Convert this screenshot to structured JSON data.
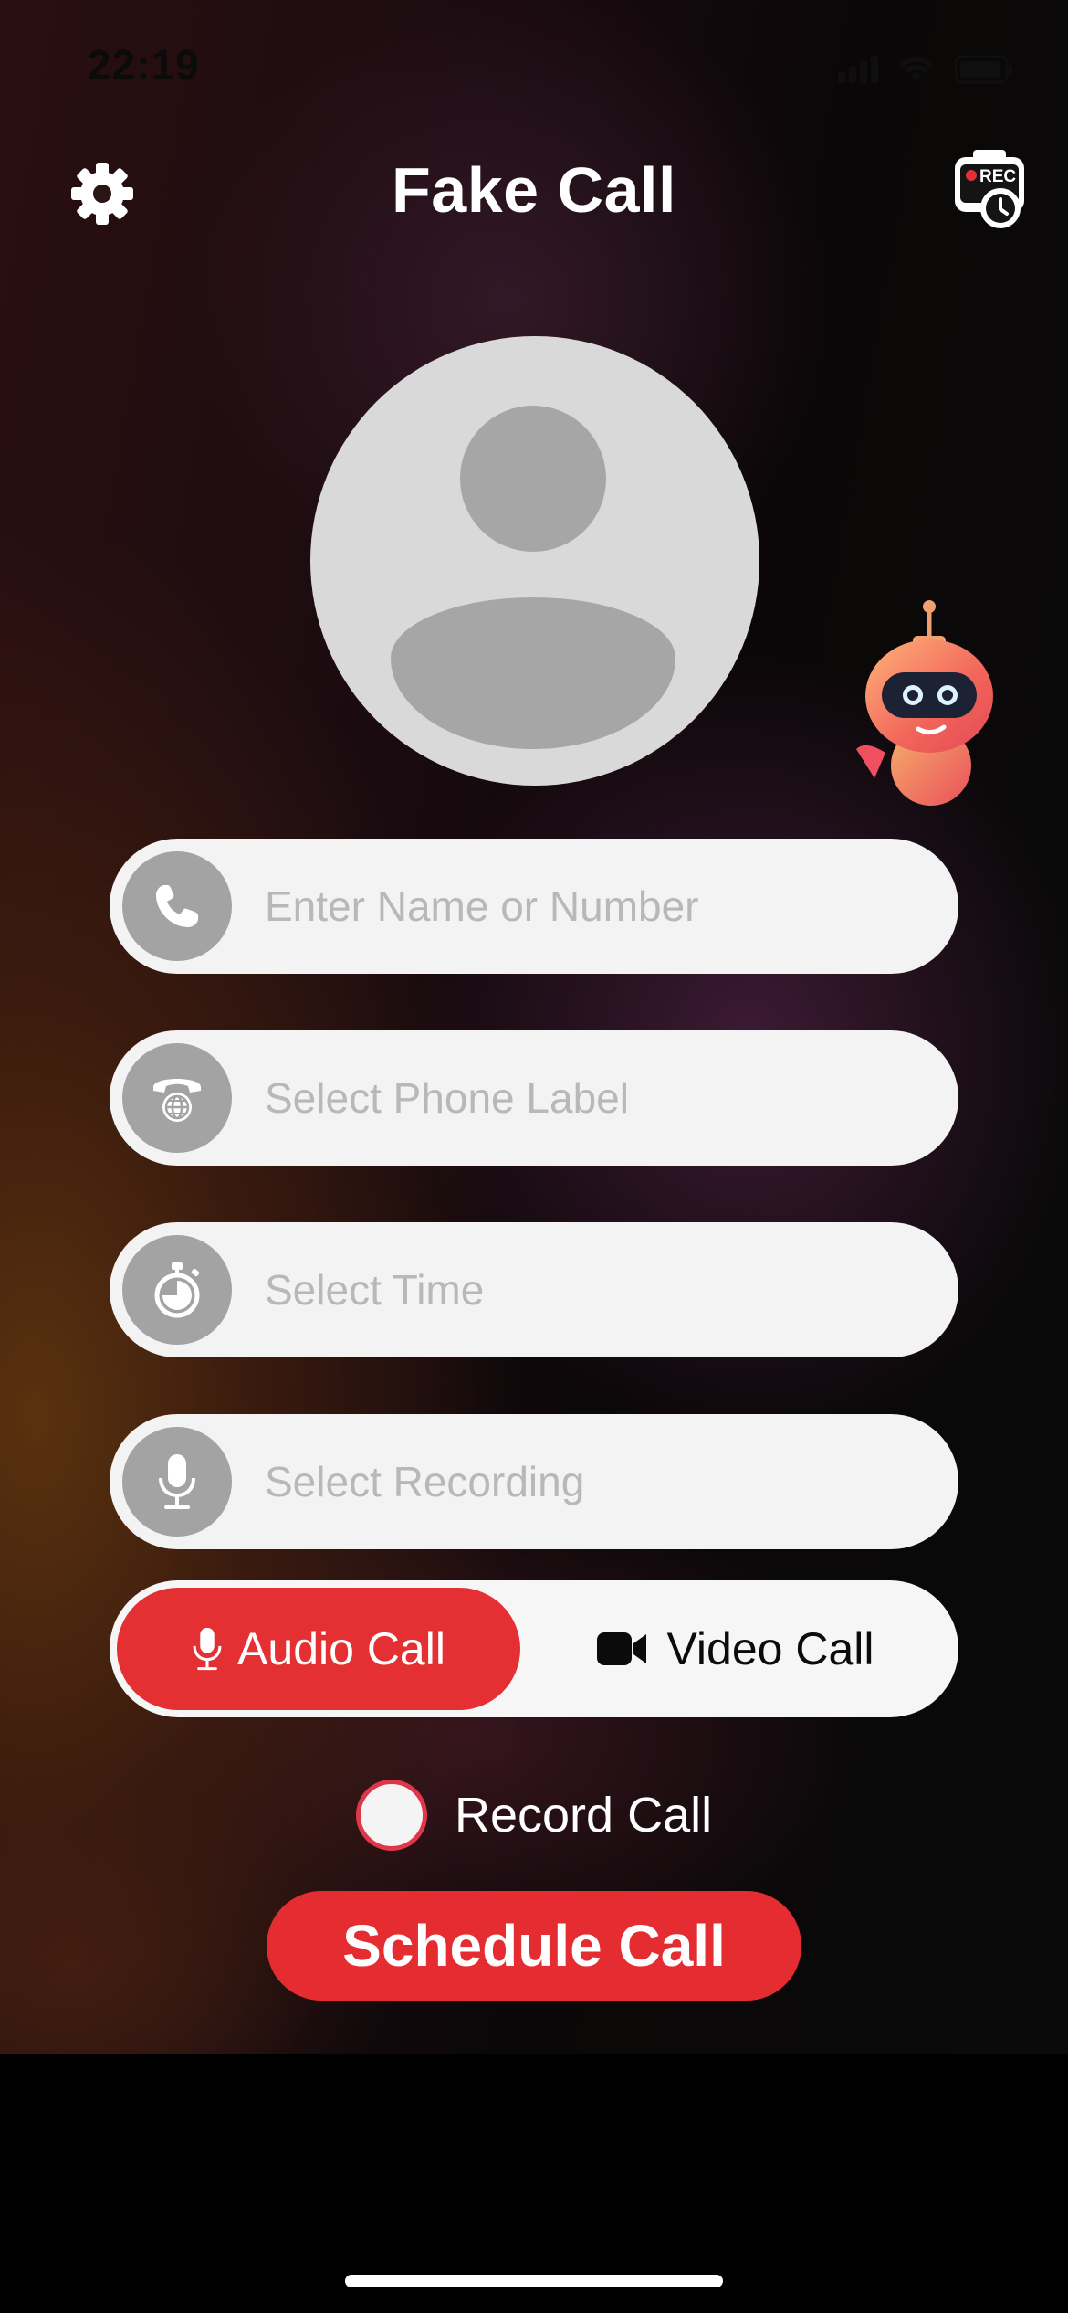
{
  "status_bar": {
    "time": "22:19",
    "icons": [
      "cellular-signal-icon",
      "wifi-icon",
      "battery-icon"
    ]
  },
  "header": {
    "title": "Fake Call",
    "left_icon": "gear-icon",
    "right_icon": "record-schedule-icon",
    "right_icon_text": "REC"
  },
  "avatar": {
    "icon": "person-placeholder-icon"
  },
  "assistant": {
    "icon": "robot-assistant-icon"
  },
  "form": {
    "name_field": {
      "placeholder": "Enter Name or Number",
      "value": "",
      "icon": "phone-icon"
    },
    "label_field": {
      "placeholder": "Select Phone Label",
      "value": "",
      "icon": "globe-phone-icon"
    },
    "time_field": {
      "placeholder": "Select Time",
      "value": "",
      "icon": "stopwatch-icon"
    },
    "recording_field": {
      "placeholder": "Select Recording",
      "value": "",
      "icon": "microphone-icon"
    }
  },
  "call_type": {
    "options": [
      {
        "label": "Audio Call",
        "icon": "microphone-icon"
      },
      {
        "label": "Video Call",
        "icon": "video-camera-icon"
      }
    ],
    "selected": "Audio Call"
  },
  "record_call": {
    "label": "Record Call",
    "checked": false
  },
  "schedule_button": {
    "label": "Schedule Call"
  },
  "colors": {
    "accent": "#e52d31",
    "field_bg": "#f3f3f3",
    "field_icon_bg": "#a3a3a3",
    "placeholder": "#b8b8b8"
  }
}
